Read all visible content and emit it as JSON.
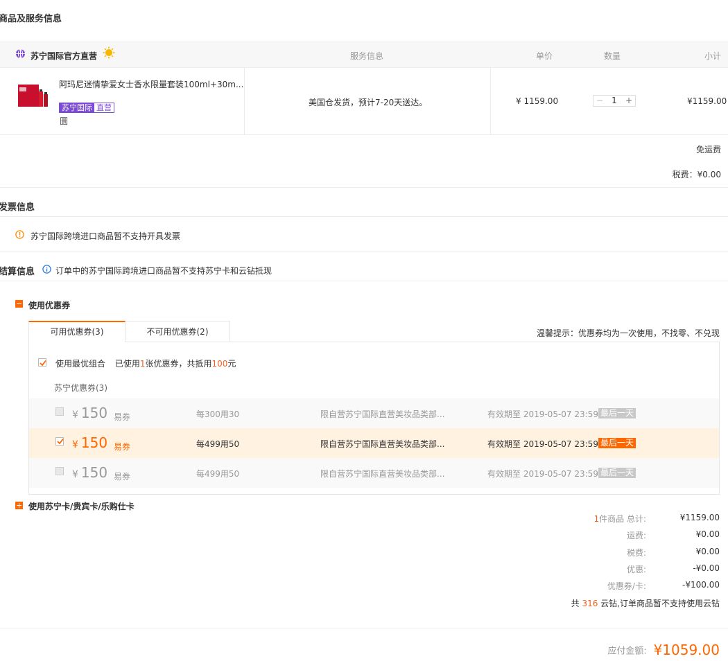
{
  "sections": {
    "product_title": "商品及服务信息",
    "invoice_title": "发票信息",
    "settle_title": "结算信息"
  },
  "table_header": {
    "shop_name": "苏宁国际官方直营",
    "service": "服务信息",
    "unit_price": "单价",
    "quantity": "数量",
    "subtotal": "小计"
  },
  "product": {
    "name": "阿玛尼迷情挚爱女士香水限量套装100ml+30m...",
    "tag_a": "苏宁国际",
    "tag_b": "直营",
    "extra_mark": "圜",
    "service": "美国仓发货，预计7-20天送达。",
    "price": "¥ 1159.00",
    "qty": "1",
    "qty_minus": "−",
    "qty_plus": "+",
    "subtotal": "¥1159.00"
  },
  "shipping": {
    "free": "免运费",
    "tax": "税费：¥0.00"
  },
  "invoice": {
    "notice": "苏宁国际跨境进口商品暂不支持开具发票"
  },
  "settle": {
    "notice": "订单中的苏宁国际跨境进口商品暂不支持苏宁卡和云钻抵现",
    "use_coupon": "使用优惠券",
    "use_cards": "使用苏宁卡/贵宾卡/乐购仕卡"
  },
  "coupon": {
    "tab_available": "可用优惠券(3)",
    "tab_unavailable": "不可用优惠券(2)",
    "tip": "温馨提示：优惠券均为一次使用，不找零、不兑现",
    "best_combo": "使用最优组合",
    "used_prefix": "已使用",
    "used_count": "1",
    "used_mid": "张优惠券，共抵用",
    "used_amount": "100",
    "used_suffix": "元",
    "group_title": "苏宁优惠券(3)",
    "items": [
      {
        "yen": "¥",
        "amount": "150",
        "kind": "易券",
        "rule": "每300用30",
        "limit": "限自营苏宁国际直营美妆品类部...",
        "expire": "有效期至 2019-05-07 23:59",
        "badge": "最后一天"
      },
      {
        "yen": "¥",
        "amount": "150",
        "kind": "易券",
        "rule": "每499用50",
        "limit": "限自营苏宁国际直营美妆品类部...",
        "expire": "有效期至 2019-05-07 23:59",
        "badge": "最后一天"
      },
      {
        "yen": "¥",
        "amount": "150",
        "kind": "易券",
        "rule": "每499用50",
        "limit": "限自营苏宁国际直营美妆品类部...",
        "expire": "有效期至 2019-05-07 23:59",
        "badge": "最后一天"
      }
    ]
  },
  "summary": {
    "count_num": "1",
    "count_label": "件商品 总计:",
    "total": "¥1159.00",
    "freight_label": "运费:",
    "freight": "¥0.00",
    "tax_label": "税费:",
    "tax": "¥0.00",
    "discount_label": "优惠:",
    "discount": "-¥0.00",
    "coupon_label": "优惠券/卡:",
    "coupon": "-¥100.00",
    "yunzuan_prefix": "共",
    "yunzuan_num": "316",
    "yunzuan_suffix": "云钻,订单商品暂不支持使用云钻",
    "payable_label": "应付金额:",
    "payable": "¥1059.00"
  },
  "colors": {
    "accent": "#ff6600",
    "tag": "#7b4bd6"
  }
}
